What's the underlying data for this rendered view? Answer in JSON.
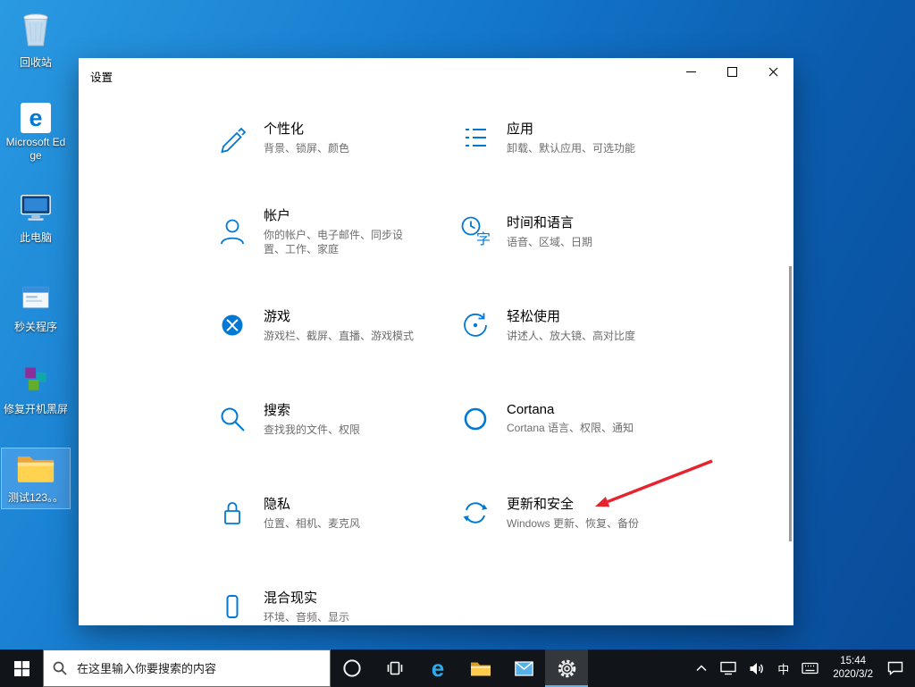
{
  "colors": {
    "accent": "#0078d4",
    "arrow_red": "#e8232e",
    "taskbar_bg": "#11151a",
    "selection_highlight": "#99c9f2"
  },
  "glyphs": {
    "edge": "e"
  },
  "desktop": {
    "icons": [
      {
        "label": "回收站"
      },
      {
        "label": "Microsoft Edge"
      },
      {
        "label": "此电脑"
      },
      {
        "label": "秒关程序"
      },
      {
        "label": "修复开机黑屏"
      },
      {
        "label": "测试123。。"
      }
    ]
  },
  "window": {
    "title": "设置"
  },
  "categories": [
    {
      "icon": "personalization-icon",
      "title": "个性化",
      "subtitle": "背景、锁屏、颜色"
    },
    {
      "icon": "apps-icon",
      "title": "应用",
      "subtitle": "卸载、默认应用、可选功能"
    },
    {
      "icon": "accounts-icon",
      "title": "帐户",
      "subtitle": "你的帐户、电子邮件、同步设置、工作、家庭"
    },
    {
      "icon": "time-language-icon",
      "title": "时间和语言",
      "subtitle": "语音、区域、日期"
    },
    {
      "icon": "gaming-icon",
      "title": "游戏",
      "subtitle": "游戏栏、截屏、直播、游戏模式"
    },
    {
      "icon": "ease-of-access-icon",
      "title": "轻松使用",
      "subtitle": "讲述人、放大镜、高对比度"
    },
    {
      "icon": "search-icon",
      "title": "搜索",
      "subtitle": "查找我的文件、权限"
    },
    {
      "icon": "cortana-icon",
      "title": "Cortana",
      "subtitle": "Cortana 语言、权限、通知"
    },
    {
      "icon": "privacy-icon",
      "title": "隐私",
      "subtitle": "位置、相机、麦克风"
    },
    {
      "icon": "update-security-icon",
      "title": "更新和安全",
      "subtitle": "Windows 更新、恢复、备份"
    },
    {
      "icon": "mixed-reality-icon",
      "title": "混合现实",
      "subtitle": "环境、音频、显示"
    }
  ],
  "taskbar": {
    "search_placeholder": "在这里输入你要搜索的内容",
    "tray": {
      "ime": "中",
      "time": "15:44",
      "date": "2020/3/2"
    }
  }
}
